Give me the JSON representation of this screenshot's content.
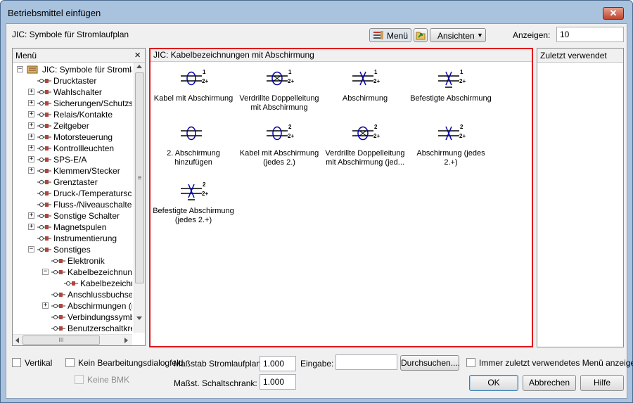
{
  "window": {
    "title": "Betriebsmittel einfügen",
    "close_glyph": "✕"
  },
  "library": {
    "label": "JIC: Symbole für Stromlaufplan"
  },
  "toolbar": {
    "menu_button": "Menü",
    "views_button": "Ansichten",
    "views_arrow": "▼",
    "display_label": "Anzeigen:",
    "display_value": "10"
  },
  "menu_pane": {
    "header": "Menü",
    "close_glyph": "×",
    "tree": [
      {
        "label": "JIC: Symbole für Stromlaufp",
        "level": 0,
        "expander": "−",
        "icon": "library-icon"
      },
      {
        "label": "Drucktaster",
        "level": 1,
        "expander": "",
        "icon": "connector-icon"
      },
      {
        "label": "Wahlschalter",
        "level": 1,
        "expander": "+",
        "icon": "connector-icon"
      },
      {
        "label": "Sicherungen/Schutzsc",
        "level": 1,
        "expander": "+",
        "icon": "connector-icon"
      },
      {
        "label": "Relais/Kontakte",
        "level": 1,
        "expander": "+",
        "icon": "connector-icon"
      },
      {
        "label": "Zeitgeber",
        "level": 1,
        "expander": "+",
        "icon": "connector-icon"
      },
      {
        "label": "Motorsteuerung",
        "level": 1,
        "expander": "+",
        "icon": "connector-icon"
      },
      {
        "label": "Kontrollleuchten",
        "level": 1,
        "expander": "+",
        "icon": "connector-icon"
      },
      {
        "label": "SPS-E/A",
        "level": 1,
        "expander": "+",
        "icon": "connector-icon"
      },
      {
        "label": "Klemmen/Stecker",
        "level": 1,
        "expander": "+",
        "icon": "connector-icon"
      },
      {
        "label": "Grenztaster",
        "level": 1,
        "expander": "",
        "icon": "connector-icon"
      },
      {
        "label": "Druck-/Temperatursch",
        "level": 1,
        "expander": "",
        "icon": "connector-icon"
      },
      {
        "label": "Fluss-/Niveauschalter",
        "level": 1,
        "expander": "",
        "icon": "connector-icon"
      },
      {
        "label": "Sonstige Schalter",
        "level": 1,
        "expander": "+",
        "icon": "connector-icon"
      },
      {
        "label": "Magnetspulen",
        "level": 1,
        "expander": "+",
        "icon": "connector-icon"
      },
      {
        "label": "Instrumentierung",
        "level": 1,
        "expander": "",
        "icon": "connector-icon"
      },
      {
        "label": "Sonstiges",
        "level": 1,
        "expander": "−",
        "icon": "connector-icon"
      },
      {
        "label": "Elektronik",
        "level": 2,
        "expander": "",
        "icon": "connector-icon"
      },
      {
        "label": "Kabelbezeichnunge",
        "level": 2,
        "expander": "−",
        "icon": "connector-icon"
      },
      {
        "label": "Kabelbezeichnu",
        "level": 3,
        "expander": "",
        "icon": "connector-icon"
      },
      {
        "label": "Anschlussbuchsen",
        "level": 2,
        "expander": "",
        "icon": "connector-icon"
      },
      {
        "label": "Abschirmungen (nic",
        "level": 2,
        "expander": "+",
        "icon": "connector-icon"
      },
      {
        "label": "Verbindungssymbol",
        "level": 2,
        "expander": "",
        "icon": "connector-icon"
      },
      {
        "label": "Benutzerschaltkreis",
        "level": 2,
        "expander": "",
        "icon": "connector-icon"
      }
    ],
    "hscroll_thumb": "III",
    "vscroll_thumb": "≡"
  },
  "content_pane": {
    "header": "JIC: Kabelbezeichnungen mit Abschirmung",
    "symbols": [
      {
        "label": "Kabel mit Abschirmung",
        "icon": "cable-shield-icon",
        "mark": "1"
      },
      {
        "label": "Verdrillte Doppelleitung mit Abschirmung",
        "icon": "twisted-pair-shield-icon",
        "mark": "1"
      },
      {
        "label": "Abschirmung",
        "icon": "shield-icon",
        "mark": "1"
      },
      {
        "label": "Befestigte Abschirmung",
        "icon": "fixed-shield-icon",
        "mark": "1"
      },
      {
        "label": "2. Abschirmung hinzufügen",
        "icon": "add-shield-icon",
        "mark": ""
      },
      {
        "label": "Kabel mit Abschirmung (jedes 2.)",
        "icon": "cable-shield-icon",
        "mark": "2"
      },
      {
        "label": "Verdrillte Doppelleitung mit Abschirmung (jed...",
        "icon": "twisted-pair-shield-icon",
        "mark": "2"
      },
      {
        "label": "Abschirmung (jedes 2.+)",
        "icon": "shield-icon",
        "mark": "2"
      },
      {
        "label": "Befestigte Abschirmung (jedes 2.+)",
        "icon": "fixed-shield-icon",
        "mark": "2"
      }
    ],
    "mark_plus": "2+"
  },
  "recent_pane": {
    "header": "Zuletzt verwendet"
  },
  "bottom": {
    "vertical_label": "Vertikal",
    "no_edit_dialog_label": "Kein Bearbeitungsdialogfeld",
    "no_bmk_label": "Keine BMK",
    "scale_schematic_label": "Maßstab Stromlaufplan:",
    "scale_schematic_value": "1.000",
    "scale_cabinet_label": "Maßst. Schaltschrank:",
    "scale_cabinet_value": "1.000",
    "input_label": "Eingabe:",
    "input_value": "",
    "browse_button": "Durchsuchen....",
    "always_recent_label": "Immer zuletzt verwendetes Menü anzeigen",
    "ok_button": "OK",
    "cancel_button": "Abbrechen",
    "help_button": "Hilfe"
  },
  "colors": {
    "highlight_border": "#e0151b",
    "title_bg": "#a9c3de"
  }
}
